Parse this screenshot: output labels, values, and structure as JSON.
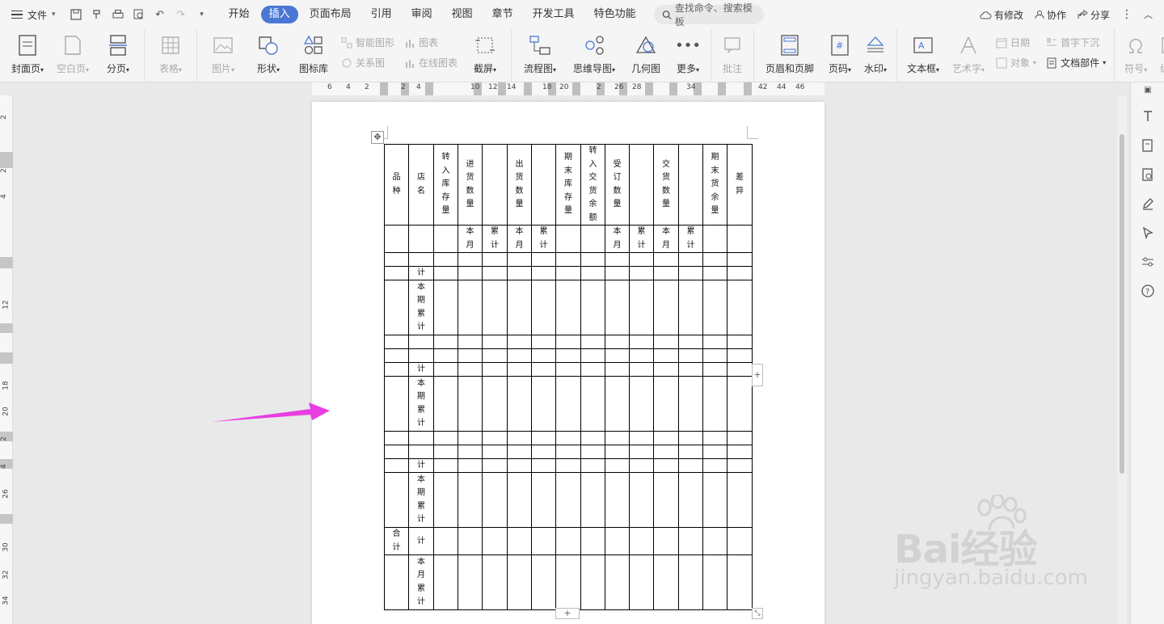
{
  "menubar": {
    "file_label": "文件",
    "tabs": [
      {
        "label": "开始",
        "active": false
      },
      {
        "label": "插入",
        "active": true
      },
      {
        "label": "页面布局",
        "active": false
      },
      {
        "label": "引用",
        "active": false
      },
      {
        "label": "审阅",
        "active": false
      },
      {
        "label": "视图",
        "active": false
      },
      {
        "label": "章节",
        "active": false
      },
      {
        "label": "开发工具",
        "active": false
      },
      {
        "label": "特色功能",
        "active": false
      }
    ],
    "search_placeholder": "查找命令、搜索模板",
    "right": {
      "modified": "有修改",
      "collaborate": "协作",
      "share": "分享"
    }
  },
  "ribbon": {
    "cover": "封面页",
    "blank": "空白页",
    "break": "分页",
    "table": "表格",
    "picture": "图片",
    "shape": "形状",
    "icon_lib": "图标库",
    "smart_shape": "智能图形",
    "chart": "图表",
    "relation": "关系图",
    "online_chart": "在线图表",
    "screenshot": "截屏",
    "flowchart": "流程图",
    "mindmap": "思维导图",
    "geometry": "几何图",
    "more": "更多",
    "comment": "批注",
    "header_footer": "页眉和页脚",
    "page_num": "页码",
    "watermark": "水印",
    "textbox": "文本框",
    "art_text": "艺术字",
    "date": "日期",
    "dropcap": "首字下沉",
    "object": "对象",
    "doc_parts": "文档部件",
    "symbol": "符号",
    "number": "编号",
    "insert": "插"
  },
  "ruler": {
    "h_numbers": [
      "6",
      "4",
      "2",
      "2",
      "4",
      "10",
      "12",
      "14",
      "18",
      "20",
      "2",
      "26",
      "28",
      "34",
      "42",
      "44",
      "46"
    ],
    "v_numbers": [
      "2",
      "2",
      "4",
      "12",
      "18",
      "20",
      "2",
      "4",
      "26",
      "30",
      "32",
      "34"
    ]
  },
  "table": {
    "header": {
      "variety": "品种",
      "store": "店名",
      "transfer_stock": "转入库存量",
      "purchase_qty": "进货数量",
      "ship_qty": "出货数量",
      "ending_stock": "期末库存量",
      "transfer_delivery_balance": "转入交货余额",
      "order_qty": "受订数量",
      "delivery_qty": "交货数量",
      "ending_delivery_balance": "期末货余量",
      "difference": "差异"
    },
    "sub": {
      "month": "本月",
      "cumulative": "累计"
    },
    "subtotal": "计",
    "period_cumulative": "本期累计",
    "total": "合计",
    "month_cumulative": "本月累计"
  },
  "watermark": {
    "brand": "Bai经验",
    "url": "jingyan.baidu.com"
  },
  "colors": {
    "active_tab": "#4a78d4",
    "arrow": "#e83ee0"
  }
}
